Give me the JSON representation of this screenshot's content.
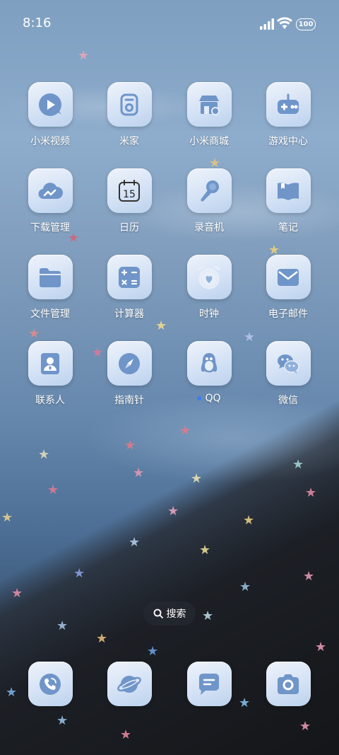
{
  "status_bar": {
    "time": "8:16",
    "battery": "100"
  },
  "apps": [
    {
      "label": "小米视频",
      "icon": "play-video-icon"
    },
    {
      "label": "米家",
      "icon": "mijia-home-device-icon"
    },
    {
      "label": "小米商城",
      "icon": "store-icon"
    },
    {
      "label": "游戏中心",
      "icon": "gamepad-icon"
    },
    {
      "label": "下载管理",
      "icon": "cloud-download-icon"
    },
    {
      "label": "日历",
      "icon": "calendar-icon",
      "calendar_day": "15"
    },
    {
      "label": "录音机",
      "icon": "microphone-icon"
    },
    {
      "label": "笔记",
      "icon": "notebook-icon"
    },
    {
      "label": "文件管理",
      "icon": "folder-icon"
    },
    {
      "label": "计算器",
      "icon": "calculator-icon"
    },
    {
      "label": "时钟",
      "icon": "alarm-clock-icon"
    },
    {
      "label": "电子邮件",
      "icon": "mail-icon"
    },
    {
      "label": "联系人",
      "icon": "contact-card-icon"
    },
    {
      "label": "指南针",
      "icon": "compass-icon"
    },
    {
      "label": "QQ",
      "icon": "qq-penguin-icon"
    },
    {
      "label": "微信",
      "icon": "wechat-icon"
    }
  ],
  "search": {
    "label": "搜索"
  },
  "dock": [
    {
      "icon": "phone-icon"
    },
    {
      "icon": "browser-planet-icon"
    },
    {
      "icon": "messages-icon"
    },
    {
      "icon": "camera-icon"
    }
  ],
  "colors": {
    "icon_glyph": "#6f95c9",
    "notification_dot": "#3b7cf6"
  }
}
